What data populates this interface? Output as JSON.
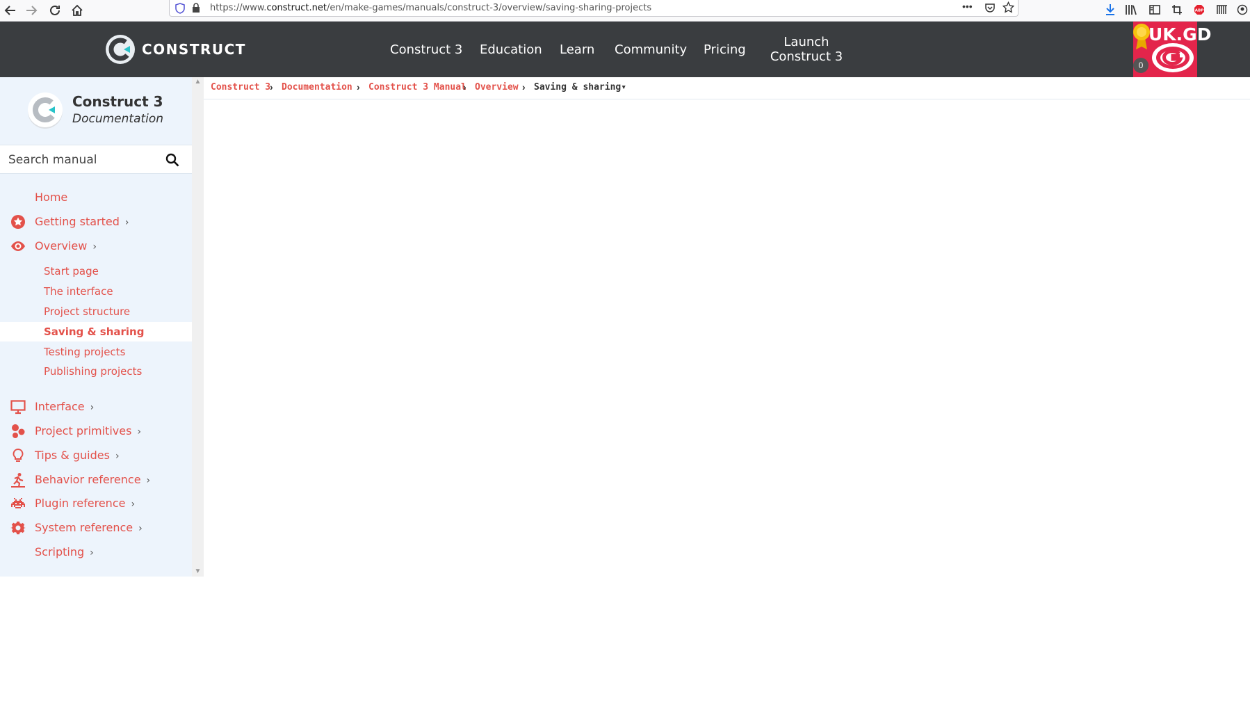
{
  "browser": {
    "url_prefix": "https://www.",
    "url_domain": "construct.net",
    "url_path": "/en/make-games/manuals/construct-3/overview/saving-sharing-projects",
    "menu_dots": "•••"
  },
  "header": {
    "logo_text": "CONSTRUCT",
    "nav": [
      "Construct 3",
      "Education",
      "Learn",
      "Community",
      "Pricing"
    ],
    "launch_line1": "Launch",
    "launch_line2": "Construct 3",
    "avatar_text": "UK.GD",
    "badge_count": "0"
  },
  "sidebar": {
    "title": "Construct 3",
    "subtitle": "Documentation",
    "search_placeholder": "Search manual",
    "items": [
      {
        "label": "Home",
        "icon": "none"
      },
      {
        "label": "Getting started",
        "icon": "star-icon"
      },
      {
        "label": "Overview",
        "icon": "eye-icon"
      }
    ],
    "overview_children": [
      "Start page",
      "The interface",
      "Project structure",
      "Saving & sharing",
      "Testing projects",
      "Publishing projects"
    ],
    "active_child": "Saving & sharing",
    "lower_items": [
      {
        "label": "Interface",
        "icon": "monitor-icon"
      },
      {
        "label": "Project primitives",
        "icon": "shapes-icon"
      },
      {
        "label": "Tips & guides",
        "icon": "lightbulb-icon"
      },
      {
        "label": "Behavior reference",
        "icon": "running-icon"
      },
      {
        "label": "Plugin reference",
        "icon": "invader-icon"
      },
      {
        "label": "System reference",
        "icon": "gear-icon"
      },
      {
        "label": "Scripting",
        "icon": "none"
      }
    ],
    "chevron": "›"
  },
  "breadcrumb": {
    "items": [
      "Construct 3",
      "Documentation",
      "Construct 3 Manual",
      "Overview"
    ],
    "current": "Saving & sharing▾",
    "separator": "›"
  },
  "colors": {
    "accent": "#e3514a",
    "header_bg": "#3a3d40",
    "sidebar_bg": "#edf4fc",
    "avatar_bg": "#e3254b"
  }
}
